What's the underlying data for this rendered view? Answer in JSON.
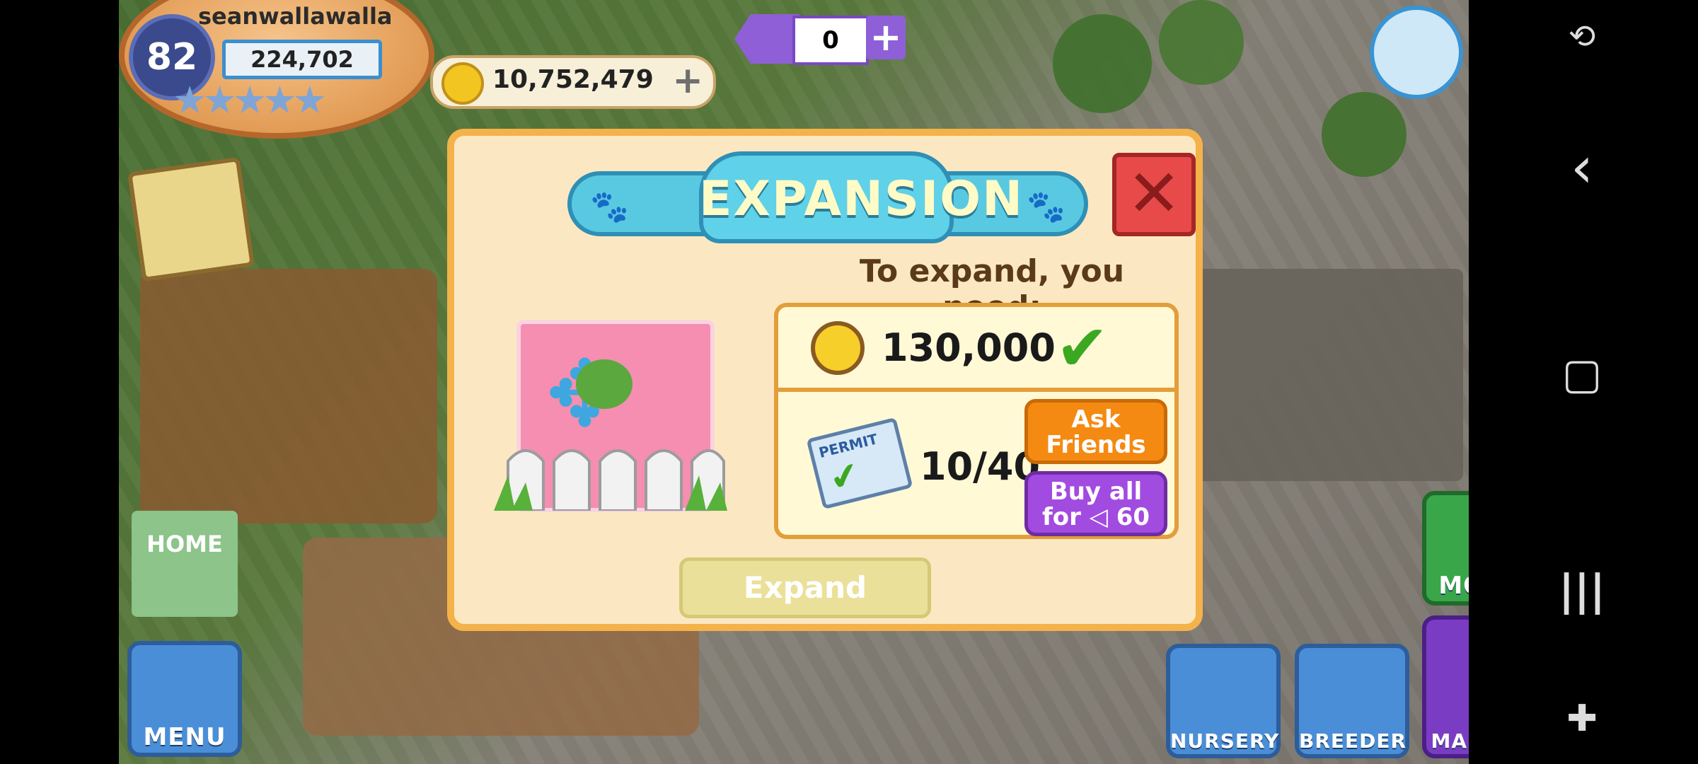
{
  "hud": {
    "level": "82",
    "username": "seanwallawalla",
    "xp": "224,702",
    "stars": "★★★★★",
    "coins": "10,752,479",
    "coins_plus": "+",
    "gems": "0",
    "gems_plus": "+"
  },
  "side_buttons": {
    "home": "HOME",
    "menu": "MENU",
    "move": "MOVE",
    "nursery": "NURSERY",
    "breeder": "BREEDER",
    "market": "MARKET"
  },
  "dialog": {
    "title": "EXPANSION",
    "close_symbol": "✕",
    "need_text": "To expand, you need:",
    "coin_cost": "130,000",
    "coin_met_icon": "✔",
    "permit_label": "PERMIT",
    "permit_count": "10/40",
    "ask_friends": "Ask Friends",
    "buy_all": "Buy all for",
    "buy_all_cost": "60",
    "expand_button": "Expand"
  },
  "nav": {
    "back_icon": "‹",
    "home_icon": "▢",
    "recents_icon": "|||"
  }
}
